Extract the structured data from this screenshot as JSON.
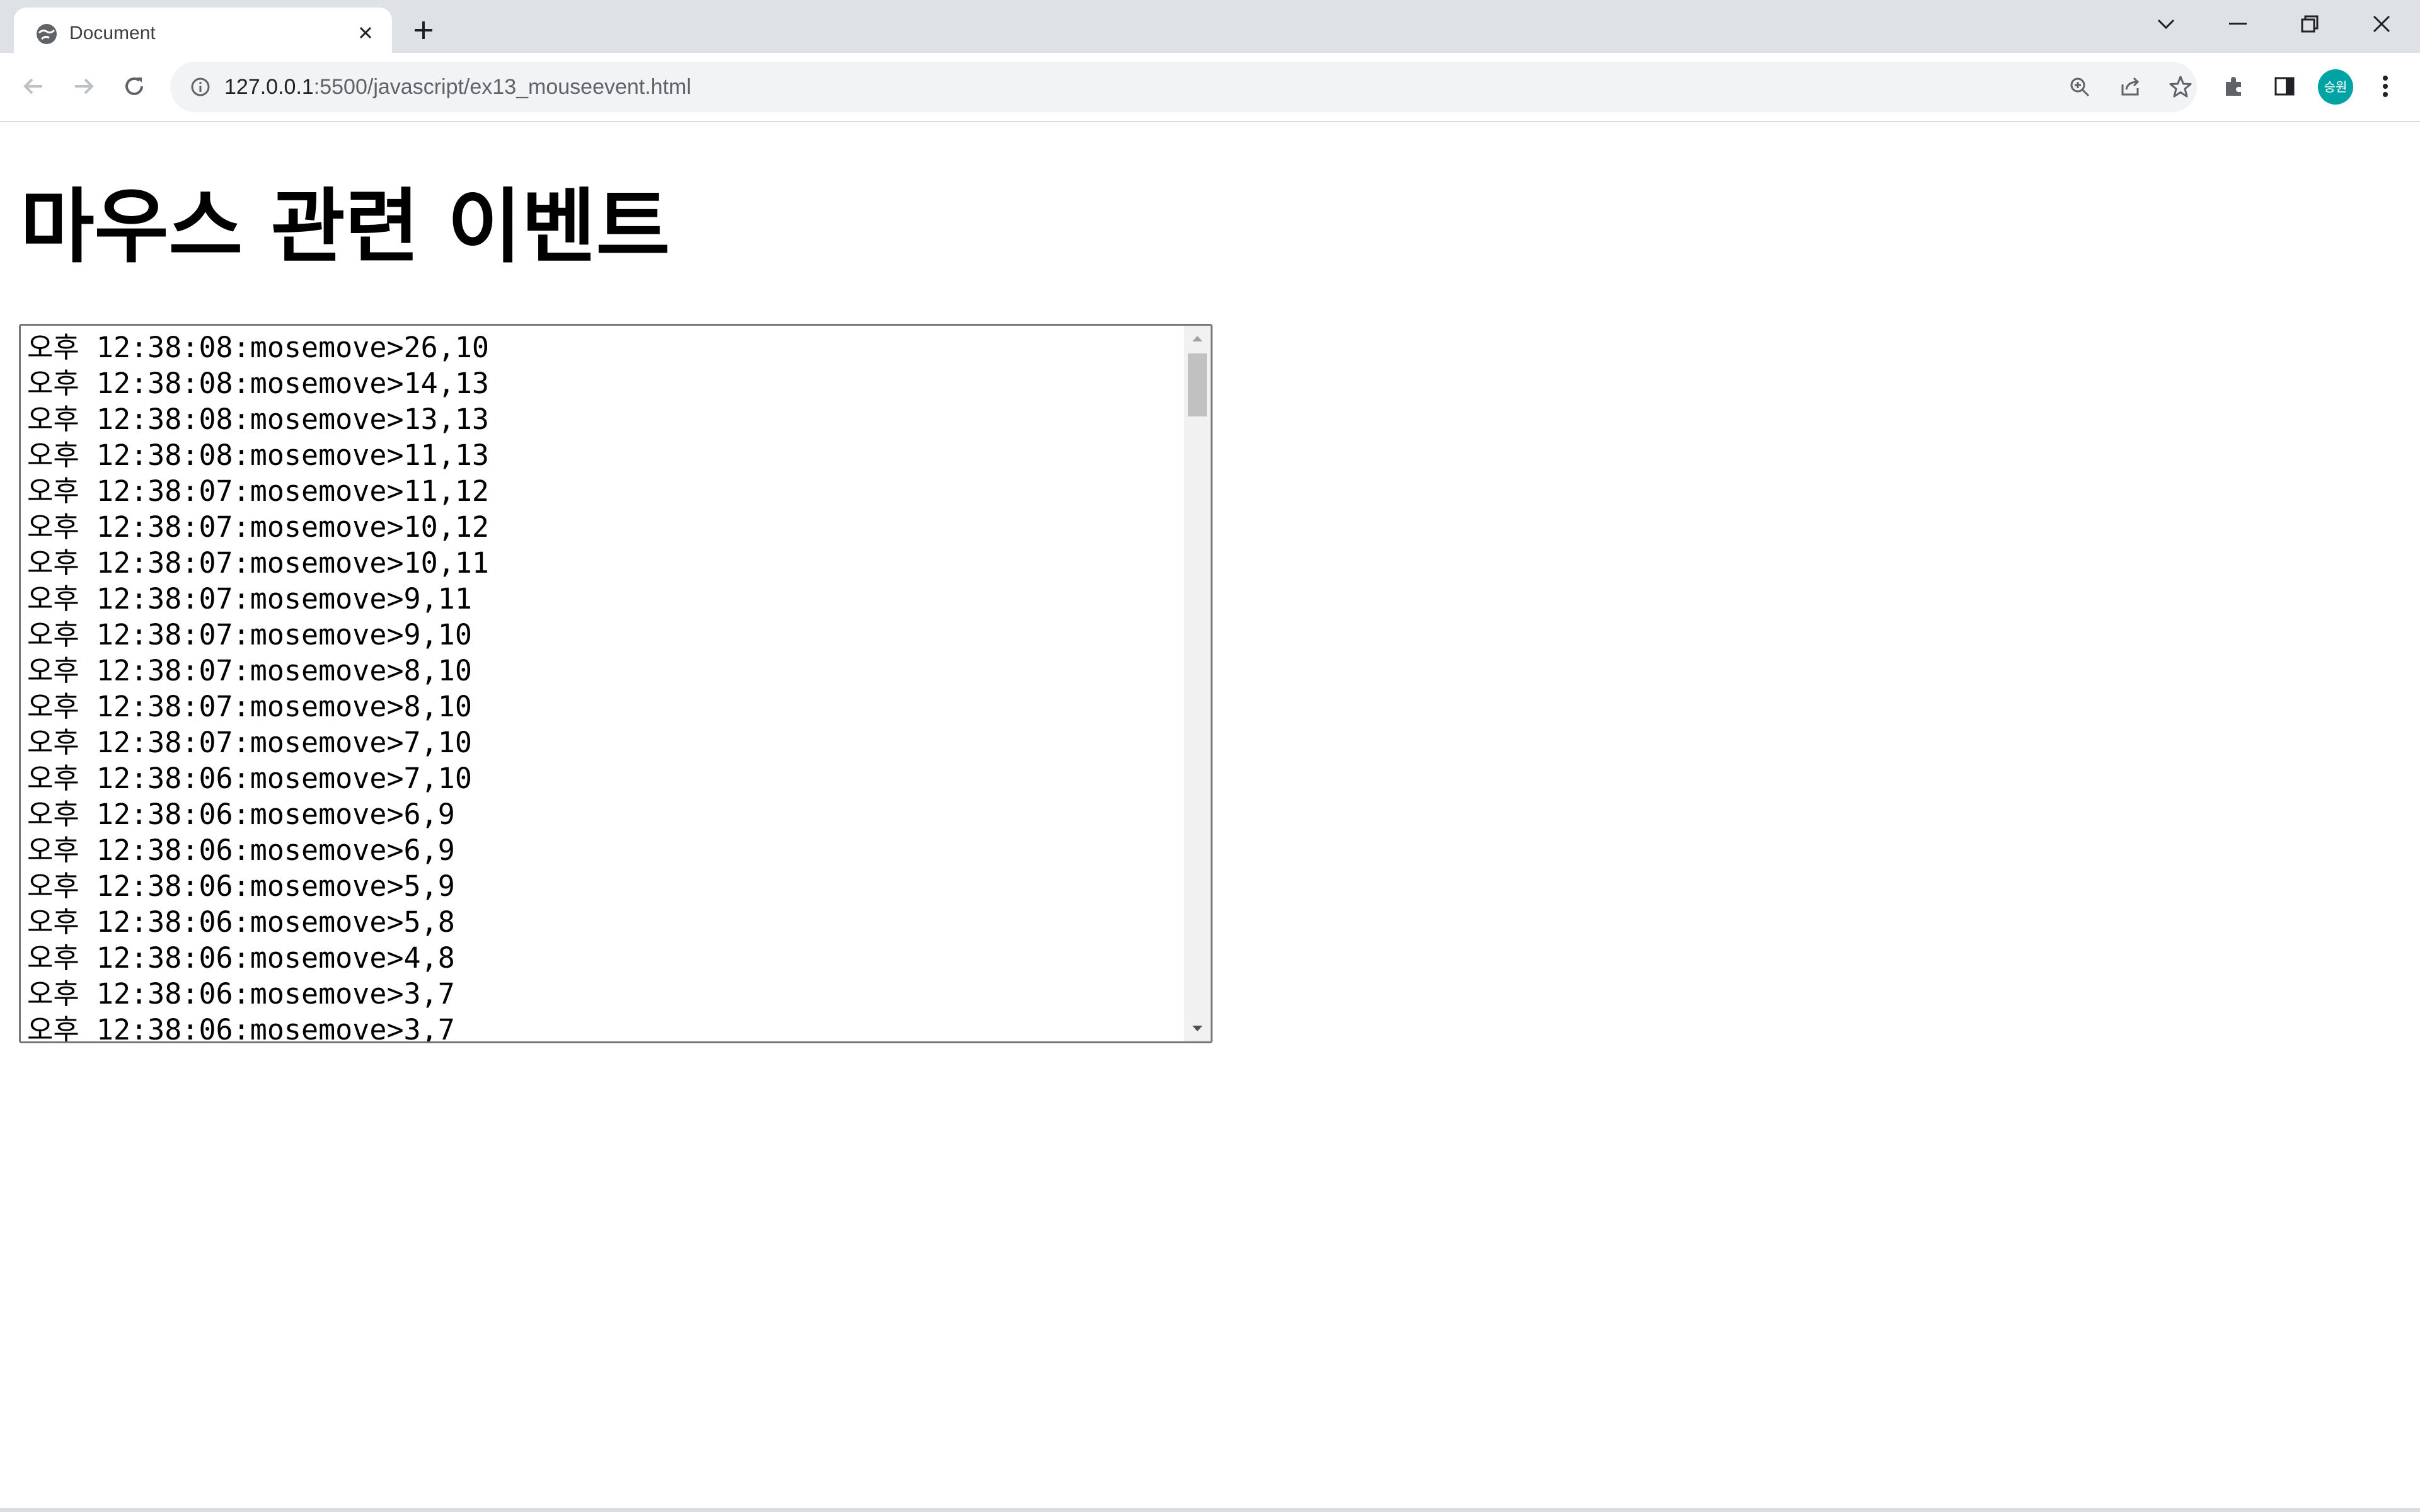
{
  "browser": {
    "tab": {
      "title": "Document",
      "favicon": "globe-icon"
    },
    "url": {
      "host": "127.0.0.1",
      "rest": ":5500/javascript/ex13_mouseevent.html"
    },
    "profile_initials": "승원",
    "icons": [
      "back-icon",
      "forward-icon",
      "reload-icon",
      "info-icon",
      "zoom-icon",
      "share-icon",
      "star-icon",
      "extensions-icon",
      "side-panel-icon",
      "menu-icon"
    ]
  },
  "page": {
    "title": "마우스 관련 이벤트",
    "log_lines": [
      "오후 12:38:08:mosemove>26,10",
      "오후 12:38:08:mosemove>14,13",
      "오후 12:38:08:mosemove>13,13",
      "오후 12:38:08:mosemove>11,13",
      "오후 12:38:07:mosemove>11,12",
      "오후 12:38:07:mosemove>10,12",
      "오후 12:38:07:mosemove>10,11",
      "오후 12:38:07:mosemove>9,11",
      "오후 12:38:07:mosemove>9,10",
      "오후 12:38:07:mosemove>8,10",
      "오후 12:38:07:mosemove>8,10",
      "오후 12:38:07:mosemove>7,10",
      "오후 12:38:06:mosemove>7,10",
      "오후 12:38:06:mosemove>6,9",
      "오후 12:38:06:mosemove>6,9",
      "오후 12:38:06:mosemove>5,9",
      "오후 12:38:06:mosemove>5,8",
      "오후 12:38:06:mosemove>4,8",
      "오후 12:38:06:mosemove>3,7",
      "오후 12:38:06:mosemove>3,7"
    ]
  }
}
